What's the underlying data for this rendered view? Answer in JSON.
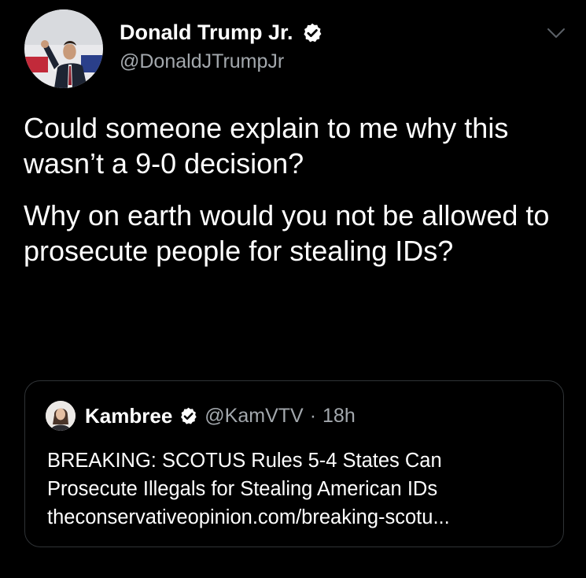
{
  "author": {
    "display_name": "Donald Trump Jr.",
    "handle": "@DonaldJTrumpJr",
    "verified": true
  },
  "tweet": {
    "paragraphs": [
      "Could someone explain to me why this wasn’t a 9-0 decision?",
      "Why on earth would you not be allowed to prosecute people for stealing IDs?"
    ]
  },
  "quoted_tweet": {
    "display_name": "Kambree",
    "handle": "@KamVTV",
    "separator": "·",
    "time": "18h",
    "verified": true,
    "text_lines": [
      "BREAKING: SCOTUS Rules 5-4 States Can",
      "Prosecute Illegals for Stealing American IDs",
      "theconservativeopinion.com/breaking-scotu..."
    ]
  },
  "colors": {
    "background": "#000000",
    "text": "#ffffff",
    "secondary_text": "#a3a8ad",
    "verified_badge": "#ffffff",
    "quote_border": "#2f3336"
  },
  "icons": {
    "verified": "verified-badge-icon",
    "menu": "chevron-down-icon"
  }
}
